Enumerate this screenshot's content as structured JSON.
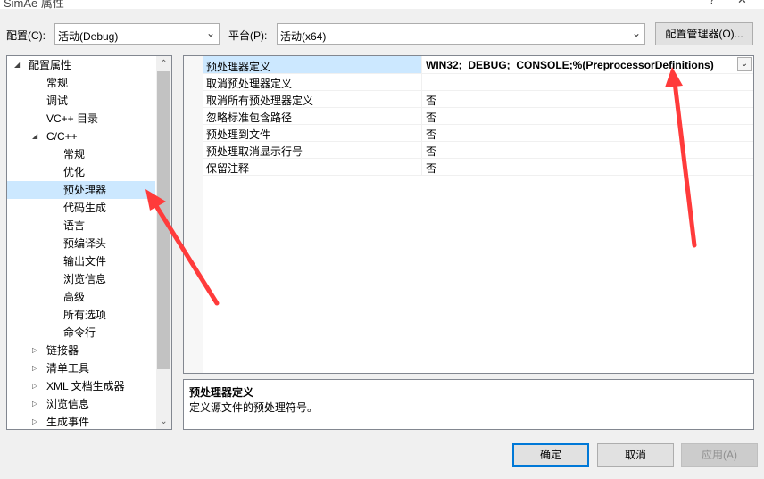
{
  "window": {
    "title_fragment": "SimAe 属性"
  },
  "toolbar": {
    "config_label": "配置(C):",
    "config_value": "活动(Debug)",
    "platform_label": "平台(P):",
    "platform_value": "活动(x64)",
    "config_manager_label": "配置管理器(O)..."
  },
  "tree": {
    "items": [
      {
        "label": "配置属性",
        "expander": "◢"
      },
      {
        "label": "常规"
      },
      {
        "label": "调试"
      },
      {
        "label": "VC++ 目录"
      },
      {
        "label": "C/C++",
        "expander": "◢"
      },
      {
        "label": "常规"
      },
      {
        "label": "优化"
      },
      {
        "label": "预处理器",
        "selected": true
      },
      {
        "label": "代码生成"
      },
      {
        "label": "语言"
      },
      {
        "label": "预编译头"
      },
      {
        "label": "输出文件"
      },
      {
        "label": "浏览信息"
      },
      {
        "label": "高级"
      },
      {
        "label": "所有选项"
      },
      {
        "label": "命令行"
      },
      {
        "label": "链接器",
        "expander": "▷"
      },
      {
        "label": "清单工具",
        "expander": "▷"
      },
      {
        "label": "XML 文档生成器",
        "expander": "▷"
      },
      {
        "label": "浏览信息",
        "expander": "▷"
      },
      {
        "label": "生成事件",
        "expander": "▷"
      }
    ]
  },
  "grid": {
    "rows": [
      {
        "name": "预处理器定义",
        "value": "WIN32;_DEBUG;_CONSOLE;%(PreprocessorDefinitions)",
        "selected": true
      },
      {
        "name": "取消预处理器定义",
        "value": ""
      },
      {
        "name": "取消所有预处理器定义",
        "value": "否"
      },
      {
        "name": "忽略标准包含路径",
        "value": "否"
      },
      {
        "name": "预处理到文件",
        "value": "否"
      },
      {
        "name": "预处理取消显示行号",
        "value": "否"
      },
      {
        "name": "保留注释",
        "value": "否"
      }
    ]
  },
  "description": {
    "title": "预处理器定义",
    "text": "定义源文件的预处理符号。"
  },
  "buttons": {
    "ok": "确定",
    "cancel": "取消",
    "apply": "应用(A)"
  },
  "colors": {
    "selection": "#cce8ff",
    "annotation_arrow": "#ff3b3b",
    "primary_border": "#0078d7"
  }
}
